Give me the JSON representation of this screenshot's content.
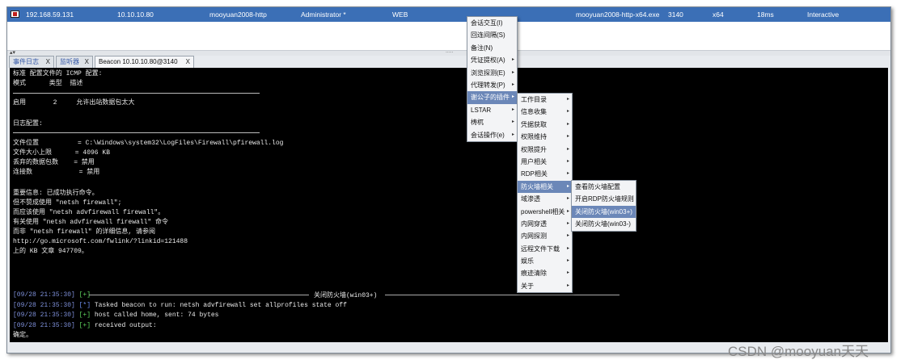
{
  "session": {
    "external_ip": "192.168.59.131",
    "internal_ip": "10.10.10.80",
    "computer": "mooyuan2008-http",
    "user": "Administrator *",
    "listener": "WEB",
    "process": "mooyuan2008-http-x64.exe",
    "pid": "3140",
    "arch": "x64",
    "last": "18ms",
    "mode": "Interactive",
    "icon": "beacon-session-icon"
  },
  "tabs": [
    {
      "label": "事件日志",
      "close": "X"
    },
    {
      "label": "监听器",
      "close": "X"
    },
    {
      "label": "Beacon 10.10.10.80@3140",
      "close": "X"
    }
  ],
  "console": {
    "lines": [
      "标准 配置文件的 ICMP 配置:",
      "模式      类型  描述",
      "启用       2     允许出站数据包太大",
      "日志配置:",
      "文件位置          = C:\\Windows\\system32\\LogFiles\\Firewall\\pfirewall.log",
      "文件大小上限      = 4096 KB",
      "丢弃的数据包数    = 禁用",
      "连接数            = 禁用",
      "重要信息: 已成功执行命令。",
      "但不赞成使用 \"netsh firewall\";",
      "而应该使用 \"netsh advfirewall firewall\"。",
      "有关使用 \"netsh advfirewall firewall\" 命令",
      "而非 \"netsh firewall\" 的详细信息, 请参阅",
      "http://go.microsoft.com/fwlink/?linkid=121488",
      "上的 KB 文章 947709。"
    ],
    "separator_title": "关闭防火墙(win03+)",
    "log": [
      {
        "time": "[09/28 21:35:30]",
        "tag": "[+]",
        "text": ""
      },
      {
        "time": "[09/28 21:35:30]",
        "tag": "[*]",
        "text": "Tasked beacon to run: netsh advfirewall set allprofiles state off"
      },
      {
        "time": "[09/28 21:35:30]",
        "tag": "[+]",
        "text": "host called home, sent: 74 bytes"
      },
      {
        "time": "[09/28 21:35:30]",
        "tag": "[+]",
        "text": "received output:"
      }
    ],
    "last_line": "确定。"
  },
  "menu1": [
    {
      "label": "会话交互(I)",
      "arrow": ""
    },
    {
      "label": "回连间隔(S)",
      "arrow": ""
    },
    {
      "label": "备注(N)",
      "arrow": ""
    },
    {
      "label": "凭证提权(A)",
      "arrow": "▸"
    },
    {
      "label": "浏览探测(E)",
      "arrow": "▸"
    },
    {
      "label": "代理转发(P)",
      "arrow": "▸"
    },
    {
      "label": "谢公子的插件",
      "arrow": "▸"
    },
    {
      "label": "LSTAR",
      "arrow": "▸"
    },
    {
      "label": "梼杌",
      "arrow": "▸"
    },
    {
      "label": "会话操作(e)",
      "arrow": "▸"
    }
  ],
  "menu2": [
    {
      "label": "工作目录",
      "arrow": "▸"
    },
    {
      "label": "信息收集",
      "arrow": "▸"
    },
    {
      "label": "凭据获取",
      "arrow": "▸"
    },
    {
      "label": "权限维持",
      "arrow": "▸"
    },
    {
      "label": "权限提升",
      "arrow": "▸"
    },
    {
      "label": "用户相关",
      "arrow": "▸"
    },
    {
      "label": "RDP相关",
      "arrow": "▸"
    },
    {
      "label": "防火墙相关",
      "arrow": "▸"
    },
    {
      "label": "域渗透",
      "arrow": "▸"
    },
    {
      "label": "powershell相关",
      "arrow": "▸"
    },
    {
      "label": "内网穿透",
      "arrow": "▸"
    },
    {
      "label": "内网探测",
      "arrow": "▸"
    },
    {
      "label": "远程文件下载",
      "arrow": "▸"
    },
    {
      "label": "娱乐",
      "arrow": "▸"
    },
    {
      "label": "痕迹清除",
      "arrow": "▸"
    },
    {
      "label": "关于",
      "arrow": "▸"
    }
  ],
  "menu3": [
    {
      "label": "查看防火墙配置"
    },
    {
      "label": "开启RDP防火墙规则"
    },
    {
      "label": "关闭防火墙(win03+)"
    },
    {
      "label": "关闭防火墙(win03-)"
    }
  ],
  "watermark": "CSDN @mooyuan天天",
  "colors": {
    "session_row": "#3b6fb6",
    "menu_highlight": "#6b87b8",
    "console_bg": "#000000"
  }
}
